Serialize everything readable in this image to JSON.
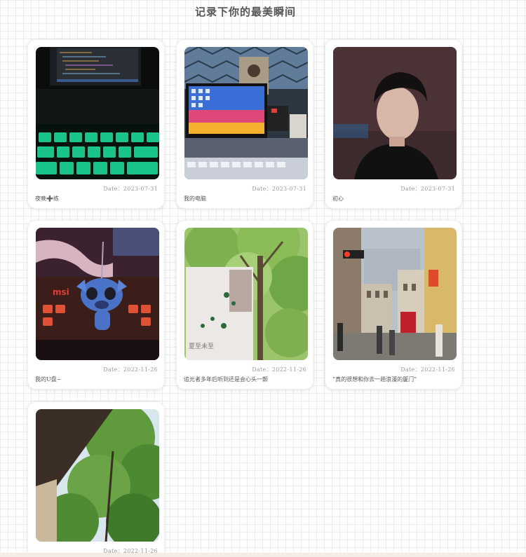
{
  "page": {
    "title": "记录下你的最美瞬间"
  },
  "cards": [
    {
      "date": "Date：2023-07-31",
      "caption": "夜晚➕练",
      "photo": "keyboard-night-photo"
    },
    {
      "date": "Date：2023-07-31",
      "caption": "我的电脑",
      "photo": "computer-desk-photo"
    },
    {
      "date": "Date：2023-07-31",
      "caption": "初心",
      "photo": "portrait-photo"
    },
    {
      "date": "Date：2022-11-26",
      "caption": "我的U盘~",
      "photo": "stitch-usb-photo"
    },
    {
      "date": "Date：2022-11-26",
      "caption": "追光者多年后听到还是会心头一颤",
      "photo": "tree-book-photo"
    },
    {
      "date": "Date：2022-11-26",
      "caption": "“真的很想和你去一趟浪漫的厦门”",
      "photo": "xiamen-street-photo"
    },
    {
      "date": "Date：2022-11-26",
      "caption": "",
      "photo": "tree-canopy-photo"
    }
  ]
}
